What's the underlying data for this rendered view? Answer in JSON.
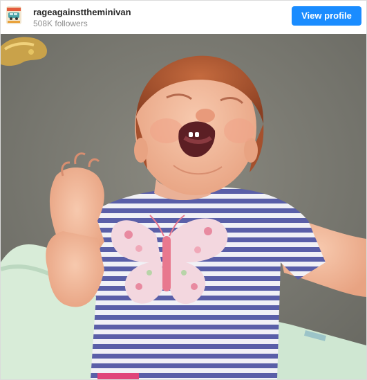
{
  "post_header": {
    "username": "rageagainsttheminivan",
    "followers": "508K followers",
    "view_profile_label": "View profile"
  },
  "colors": {
    "button": "#1a8cff",
    "username": "#262626",
    "followers": "#8e8e8e",
    "carpet": "#7b7a72",
    "shirt_stripe": "#5a5fa8"
  },
  "icons": {
    "avatar": "profile-avatar-minivan-icon"
  }
}
